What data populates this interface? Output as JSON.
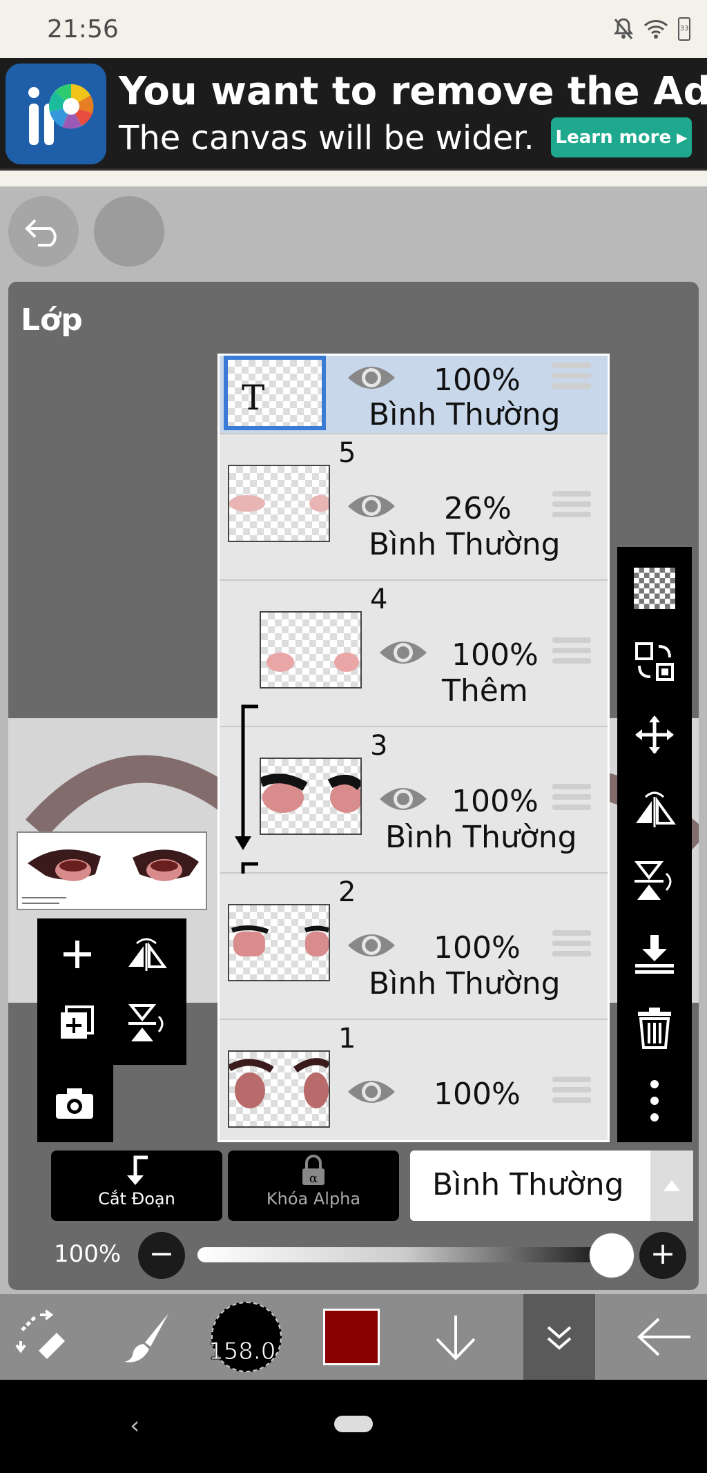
{
  "status_bar": {
    "time": "21:56",
    "battery": "33"
  },
  "ad": {
    "title": "You want to remove the Ad?",
    "subtitle": "The canvas will be wider.",
    "button_label": "Learn more"
  },
  "panel": {
    "title": "Lớp"
  },
  "layers": [
    {
      "number": "",
      "thumb_text": "T",
      "opacity": "100%",
      "blend": "Bình Thường",
      "selected": true
    },
    {
      "number": "5",
      "opacity": "26%",
      "blend": "Bình Thường",
      "selected": false
    },
    {
      "number": "4",
      "opacity": "100%",
      "blend": "Thêm",
      "clipped": true,
      "selected": false
    },
    {
      "number": "3",
      "opacity": "100%",
      "blend": "Bình Thường",
      "clipped": true,
      "selected": false
    },
    {
      "number": "2",
      "opacity": "100%",
      "blend": "Bình Thường",
      "selected": false
    },
    {
      "number": "1",
      "opacity": "100%",
      "blend": "",
      "selected": false
    }
  ],
  "actions": {
    "clip_label": "Cắt Đoạn",
    "alpha_lock_label": "Khóa Alpha",
    "blend_mode": "Bình Thường"
  },
  "opacity": {
    "label": "100%",
    "value": 1.0
  },
  "toolbar": {
    "brush_size": "158.0",
    "color": "#8b0000"
  },
  "colors": {
    "accent": "#1ea98e",
    "selected_layer": "#c8d7ea",
    "selected_border": "#3a7bd5"
  }
}
